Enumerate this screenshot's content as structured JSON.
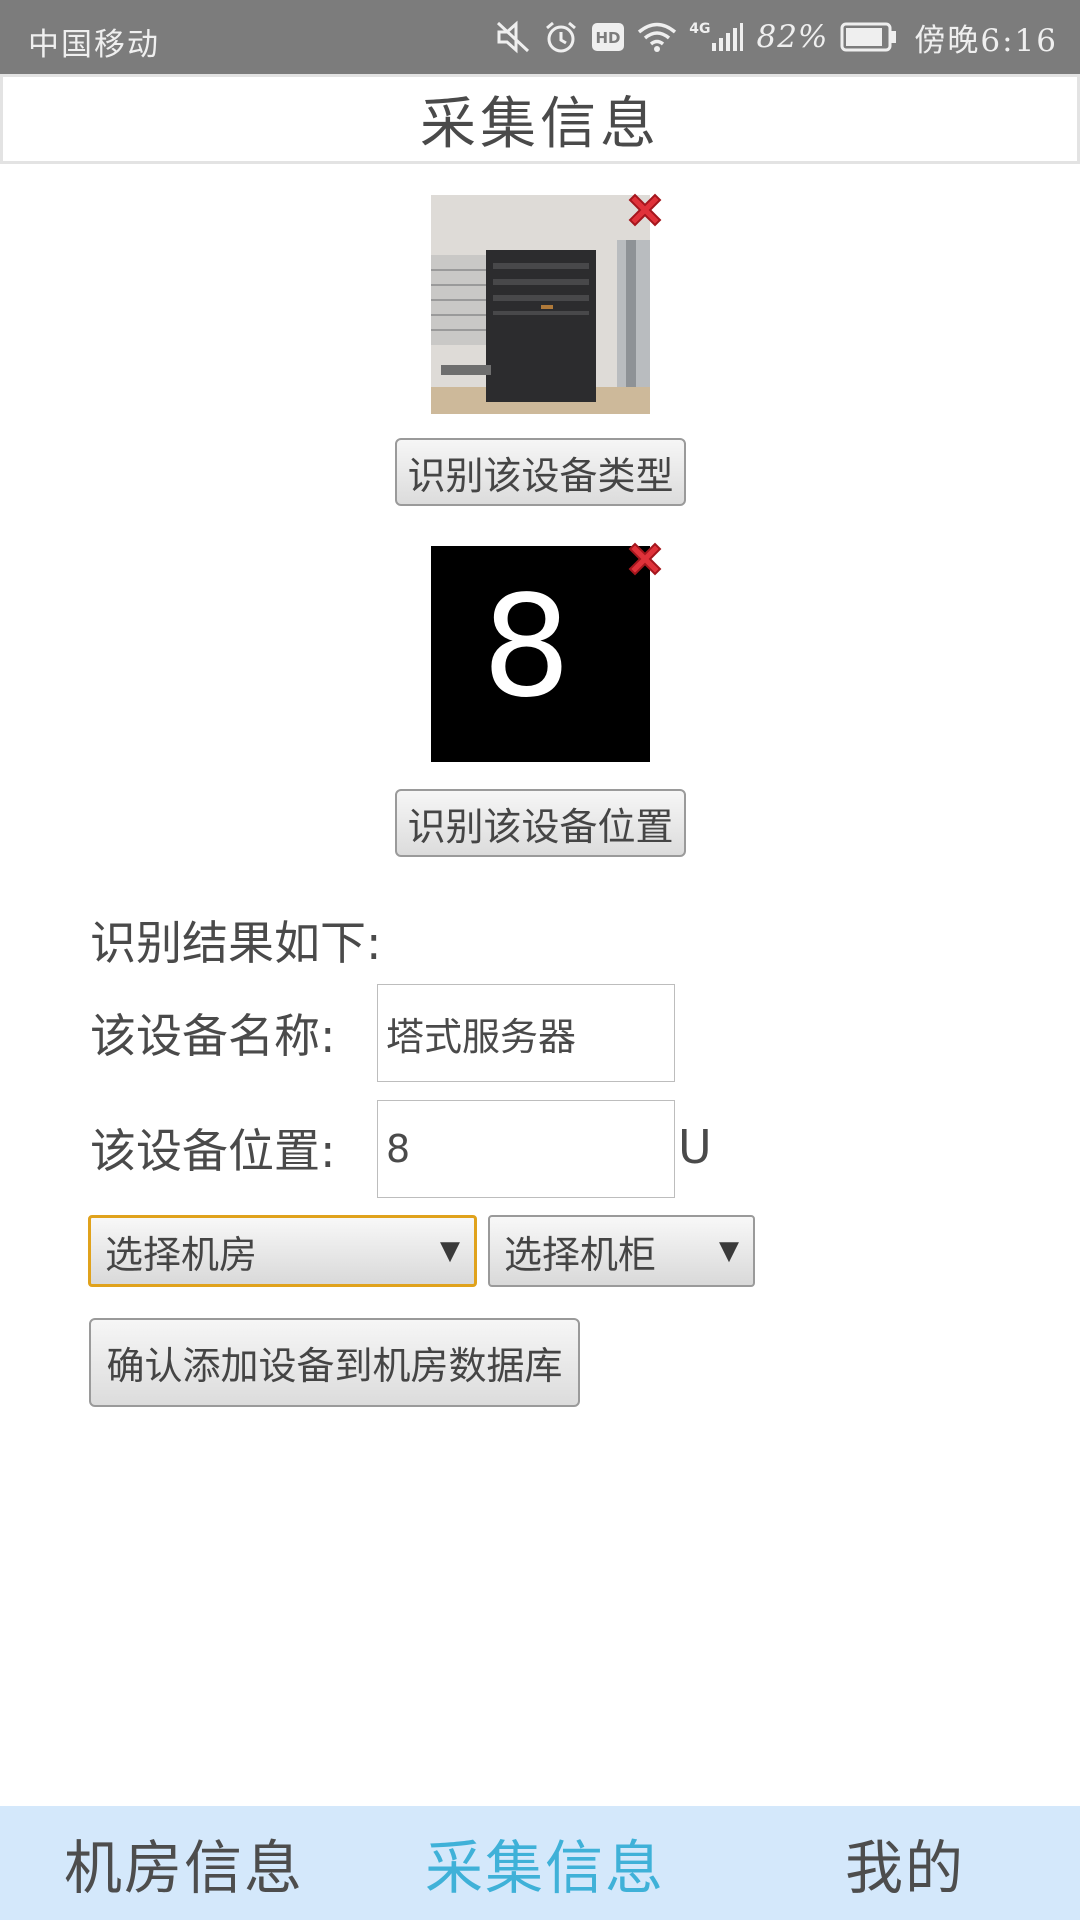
{
  "status_bar": {
    "carrier": "中国移动",
    "network": "4G",
    "battery": "82%",
    "time": "傍晚6:16",
    "icons": [
      "mute-icon",
      "alarm-icon",
      "hd-icon",
      "wifi-icon",
      "signal-icon",
      "battery-icon"
    ]
  },
  "header": {
    "title": "采集信息"
  },
  "photos": [
    {
      "description": "tower-server-photo"
    },
    {
      "digit": "8"
    }
  ],
  "buttons": {
    "identify_type": "识别该设备类型",
    "identify_position": "识别该设备位置",
    "confirm_add": "确认添加设备到机房数据库"
  },
  "form": {
    "results_heading": "识别结果如下:",
    "name_label": "该设备名称:",
    "name_value": "塔式服务器",
    "position_label": "该设备位置:",
    "position_value": "8",
    "position_unit": "U",
    "room_select": "选择机房",
    "cabinet_select": "选择机柜"
  },
  "bottom_nav": {
    "items": [
      "机房信息",
      "采集信息",
      "我的"
    ],
    "active": "采集信息",
    "active_color": "#3fb1d8"
  },
  "colors": {
    "status_bar_bg": "#7c7c7c",
    "nav_bg": "#d4e8fb",
    "select_focus_border": "#e0a21c",
    "delete_red": "#e0323a"
  }
}
